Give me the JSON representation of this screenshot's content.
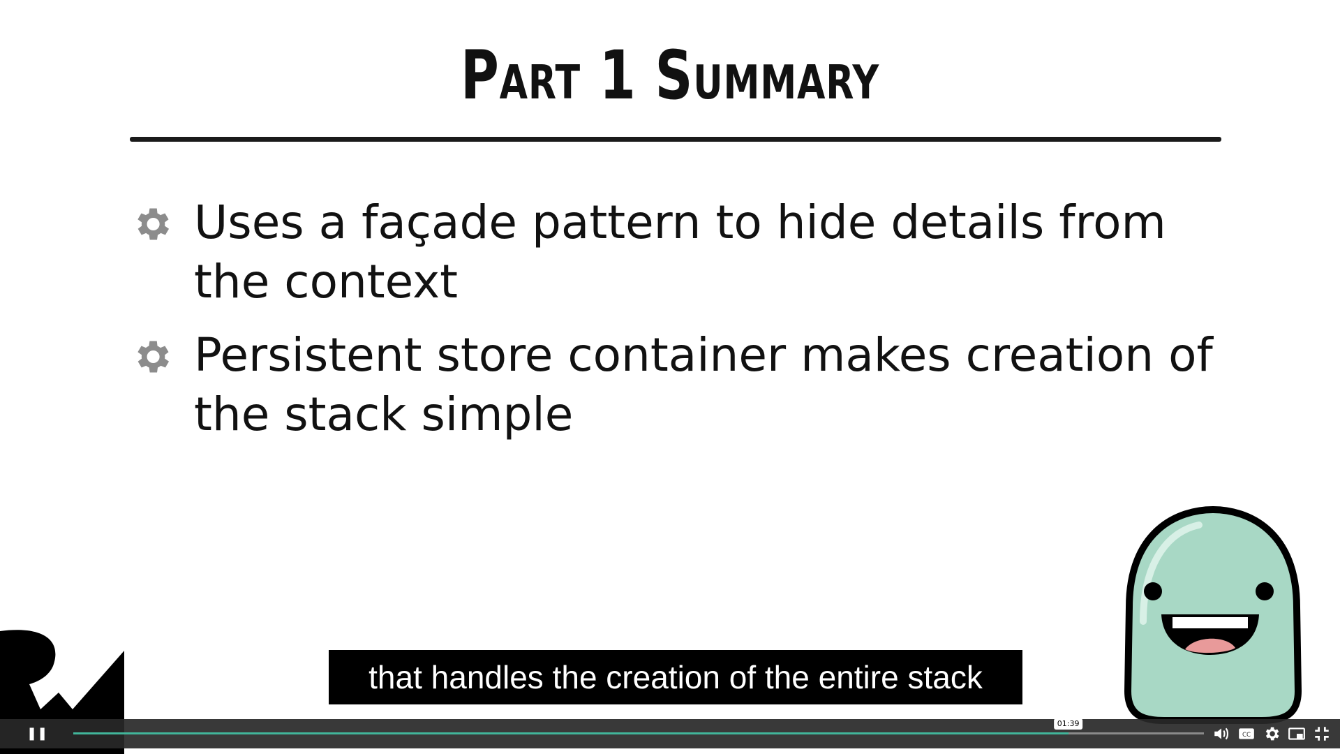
{
  "slide": {
    "title": "Part 1 Summary",
    "bullets": [
      "Uses a façade pattern to hide details from the context",
      "Persistent store container makes creation of the stack simple"
    ]
  },
  "caption": "that handles the creation of the entire stack",
  "player": {
    "current_time": "01:39",
    "progress_fraction": 0.88,
    "accent_color": "#41b59a",
    "icons": [
      "pause-icon",
      "volume-icon",
      "closed-captions-icon",
      "settings-gear-icon",
      "picture-in-picture-icon",
      "exit-fullscreen-icon"
    ]
  },
  "colors": {
    "bullet_gear": "#8c8c8c",
    "mascot_body": "#a8d8c5",
    "caption_bg": "#000000"
  }
}
